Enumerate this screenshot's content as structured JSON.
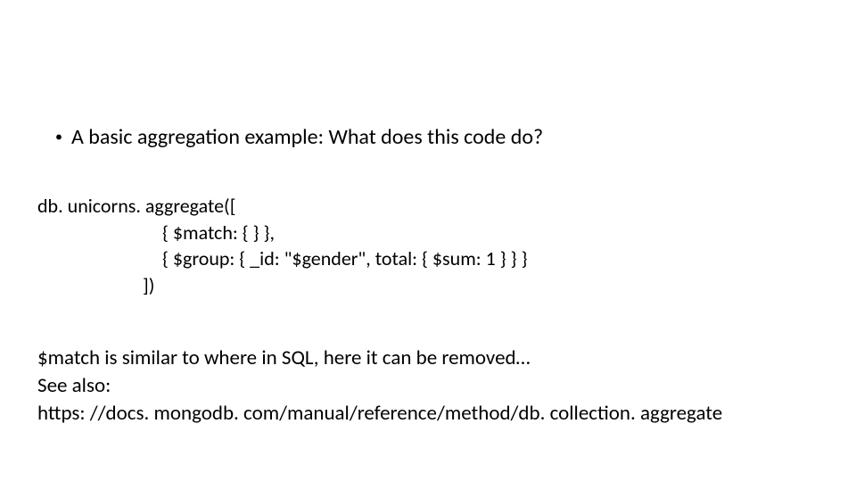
{
  "bullet": {
    "dot": "•",
    "text": "A basic aggregation example: What does this code do?"
  },
  "code": {
    "line1": "db. unicorns. aggregate([",
    "line2": "{ $match: { } },",
    "line3": "{ $group: { _id: \"$gender\", total: { $sum: 1 } } }",
    "line4": "])"
  },
  "explanation": {
    "line1": "$match is similar to where in SQL, here it can be removed…",
    "line2": "See also:",
    "line3": "https: //docs. mongodb. com/manual/reference/method/db. collection. aggregate"
  }
}
